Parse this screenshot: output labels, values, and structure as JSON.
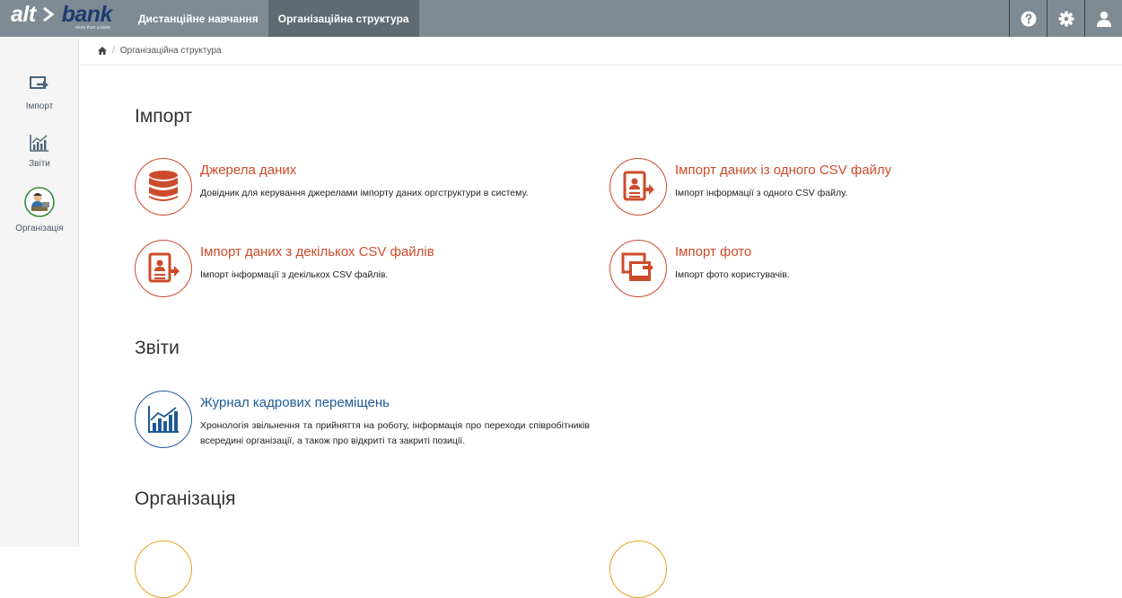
{
  "brand": {
    "name_left": "alt",
    "name_right": "bank",
    "tagline": "more than a bank"
  },
  "topnav": {
    "tabs": [
      {
        "label": "Дистанційне навчання",
        "active": false
      },
      {
        "label": "Організаційна структура",
        "active": true
      }
    ]
  },
  "topicons": [
    "help-icon",
    "settings-gear-icon",
    "user-icon"
  ],
  "sidebar": {
    "items": [
      {
        "label": "Імпорт",
        "icon": "import-icon"
      },
      {
        "label": "Звіти",
        "icon": "reports-chart-icon"
      },
      {
        "label": "Організація",
        "icon": "organization-person-icon"
      }
    ]
  },
  "breadcrumb": {
    "current": "Організаційна структура"
  },
  "sections": {
    "import": {
      "title": "Імпорт",
      "cards": [
        {
          "title": "Джерела даних",
          "desc": "Довідник для керування джерелами імпорту даних оргструктури в систему."
        },
        {
          "title": "Імпорт даних із одного CSV файлу",
          "desc": "Імпорт інформації з одного CSV файлу."
        },
        {
          "title": "Імпорт даних з декількох CSV файлів",
          "desc": "Імпорт інформації з декількох CSV файлів."
        },
        {
          "title": "Імпорт фото",
          "desc": "Імпорт фото користувачів."
        }
      ]
    },
    "reports": {
      "title": "Звіти",
      "cards": [
        {
          "title": "Журнал кадрових переміщень",
          "desc": "Хронологія звільнення та прийняття на роботу, інформація про переходи співробітників всередині організації, а також про відкриті та закриті позиції."
        }
      ]
    },
    "organization": {
      "title": "Організація"
    }
  },
  "colors": {
    "topbar": "#7e8b94",
    "accent_orange": "#cc4b2a",
    "accent_blue": "#1f5a96"
  }
}
